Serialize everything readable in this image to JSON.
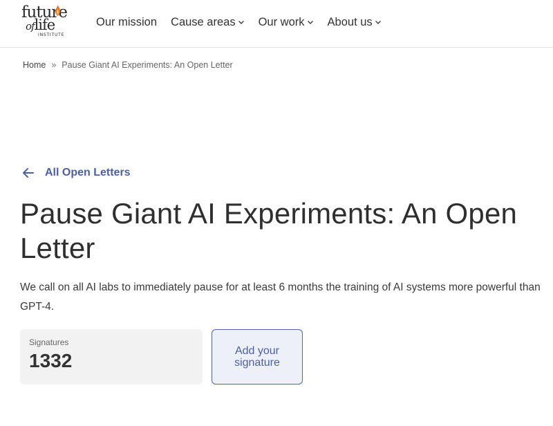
{
  "header": {
    "logo": {
      "line1": "future",
      "line2_of": "of",
      "line2_life": "life",
      "line3": "INSTITUTE",
      "icon": "flame-icon"
    },
    "nav": [
      {
        "label": "Our mission",
        "dropdown": false
      },
      {
        "label": "Cause areas",
        "dropdown": true
      },
      {
        "label": "Our work",
        "dropdown": true
      },
      {
        "label": "About us",
        "dropdown": true
      }
    ]
  },
  "breadcrumb": {
    "home": "Home",
    "separator": "»",
    "current": "Pause Giant AI Experiments: An Open Letter"
  },
  "main": {
    "back_link": "All Open Letters",
    "back_icon": "arrow-left-icon",
    "title": "Pause Giant AI Experiments: An Open Letter",
    "description": "We call on all AI labs to immediately pause for at least 6 months the training of AI systems more powerful than GPT-4.",
    "signatures": {
      "label": "Signatures",
      "count": "1332"
    },
    "add_signature_label": "Add your signature"
  },
  "colors": {
    "accent": "#4a5fa8",
    "flame": "#e07a2e",
    "sig_box_bg": "#f2f2f2",
    "button_bg": "#eef0f8"
  }
}
